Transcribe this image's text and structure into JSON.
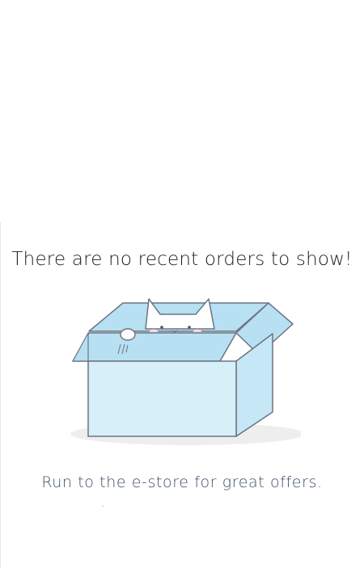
{
  "empty_state": {
    "headline": "There are no recent orders to show!",
    "subtext": "Run to the e-store for great offers.",
    "illustration_icon": "cat-in-box-icon"
  },
  "colors": {
    "headline_text": "#1d1d1d",
    "subtext": "#3d4f66",
    "box_fill": "#d6eff8",
    "box_flap": "#b7e0f2",
    "box_stroke": "#6b7480",
    "shadow": "#eeeeee"
  }
}
